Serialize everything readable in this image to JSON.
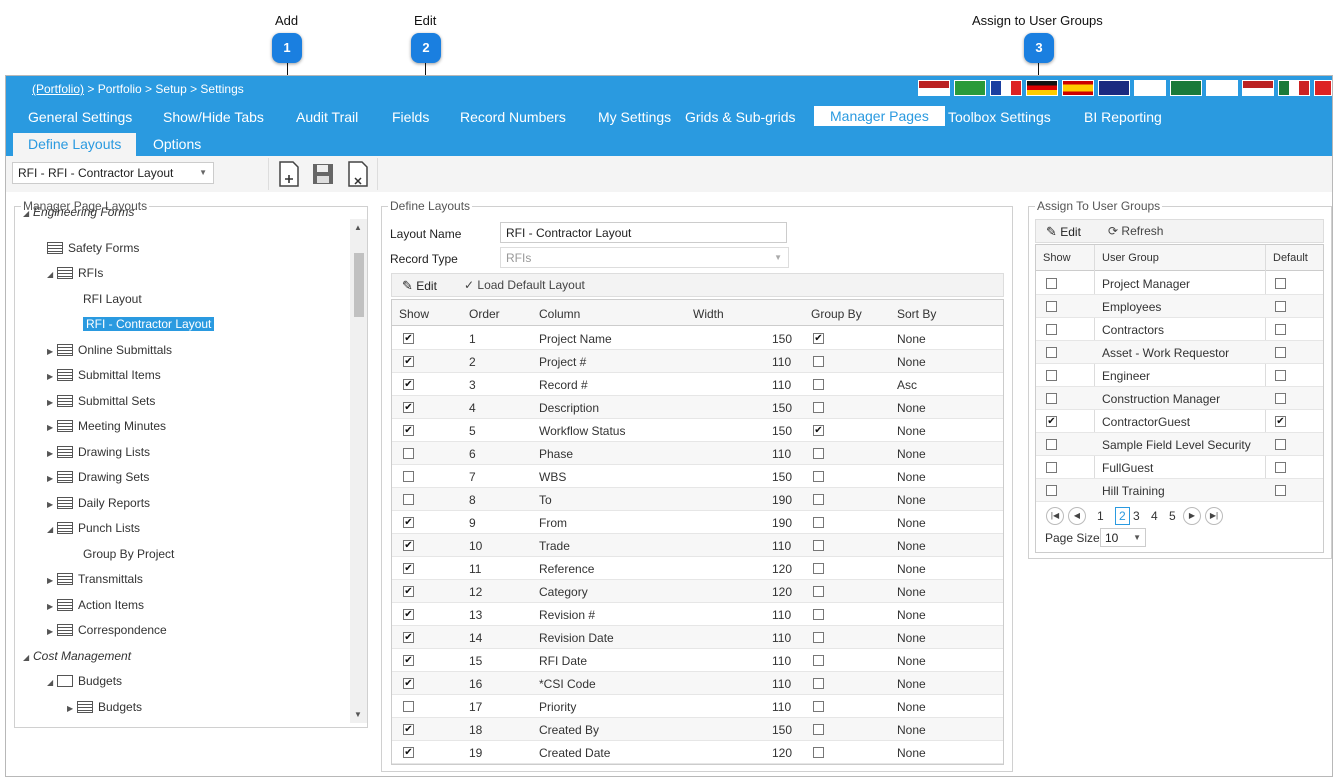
{
  "callouts": [
    {
      "label": "Add",
      "number": "1"
    },
    {
      "label": "Edit",
      "number": "2"
    },
    {
      "label": "Assign to User Groups",
      "number": "3"
    }
  ],
  "breadcrumb": {
    "link": "(Portfolio)",
    "rest": " > Portfolio > Setup > Settings"
  },
  "nav": [
    "General Settings",
    "Show/Hide Tabs",
    "Audit Trail",
    "Fields",
    "Record Numbers",
    "My Settings",
    "Grids & Sub-grids",
    "Manager Pages",
    "Toolbox Settings",
    "BI Reporting"
  ],
  "subtabs": [
    "Define Layouts",
    "Options"
  ],
  "layout_select": "RFI - RFI - Contractor Layout",
  "left_panel": {
    "legend": "Manager Page Layouts",
    "tree": [
      {
        "label": "Engineering Forms",
        "level": 0,
        "icon": "none",
        "exp": "open",
        "italic": true
      },
      {
        "label": "Safety Forms",
        "level": 1,
        "icon": "grid",
        "exp": "none"
      },
      {
        "label": "RFIs",
        "level": 1,
        "icon": "grid",
        "exp": "open"
      },
      {
        "label": "RFI Layout",
        "level": 2,
        "icon": "none",
        "exp": "none"
      },
      {
        "label": "RFI - Contractor Layout",
        "level": 2,
        "icon": "none",
        "exp": "none",
        "selected": true
      },
      {
        "label": "Online Submittals",
        "level": 1,
        "icon": "grid",
        "exp": "closed"
      },
      {
        "label": "Submittal Items",
        "level": 1,
        "icon": "grid",
        "exp": "closed"
      },
      {
        "label": "Submittal Sets",
        "level": 1,
        "icon": "grid",
        "exp": "closed"
      },
      {
        "label": "Meeting Minutes",
        "level": 1,
        "icon": "grid",
        "exp": "closed"
      },
      {
        "label": "Drawing Lists",
        "level": 1,
        "icon": "grid",
        "exp": "closed"
      },
      {
        "label": "Drawing Sets",
        "level": 1,
        "icon": "grid",
        "exp": "closed"
      },
      {
        "label": "Daily Reports",
        "level": 1,
        "icon": "grid",
        "exp": "closed"
      },
      {
        "label": "Punch Lists",
        "level": 1,
        "icon": "grid",
        "exp": "open"
      },
      {
        "label": "Group By Project",
        "level": 2,
        "icon": "none",
        "exp": "none"
      },
      {
        "label": "Transmittals",
        "level": 1,
        "icon": "grid",
        "exp": "closed"
      },
      {
        "label": "Action Items",
        "level": 1,
        "icon": "grid",
        "exp": "closed"
      },
      {
        "label": "Correspondence",
        "level": 1,
        "icon": "grid",
        "exp": "closed"
      },
      {
        "label": "Cost Management",
        "level": 0,
        "icon": "none",
        "exp": "open",
        "italic": true
      },
      {
        "label": "Budgets",
        "level": 1,
        "icon": "folder",
        "exp": "open"
      },
      {
        "label": "Budgets",
        "level": 2,
        "icon": "grid",
        "exp": "closed"
      }
    ]
  },
  "define_layouts": {
    "legend": "Define Layouts",
    "layout_name_label": "Layout Name",
    "layout_name_value": "RFI - Contractor Layout",
    "record_type_label": "Record Type",
    "record_type_value": "RFIs",
    "edit_label": "Edit",
    "load_default_label": "Load Default Layout",
    "columns": [
      "Show",
      "Order",
      "Column",
      "Width",
      "Group By",
      "Sort By"
    ],
    "rows": [
      {
        "show": true,
        "order": "1",
        "column": "Project Name",
        "width": "150",
        "group": true,
        "sort": "None"
      },
      {
        "show": true,
        "order": "2",
        "column": "Project #",
        "width": "110",
        "group": false,
        "sort": "None"
      },
      {
        "show": true,
        "order": "3",
        "column": "Record #",
        "width": "110",
        "group": false,
        "sort": "Asc"
      },
      {
        "show": true,
        "order": "4",
        "column": "Description",
        "width": "150",
        "group": false,
        "sort": "None"
      },
      {
        "show": true,
        "order": "5",
        "column": "Workflow Status",
        "width": "150",
        "group": true,
        "sort": "None"
      },
      {
        "show": false,
        "order": "6",
        "column": "Phase",
        "width": "110",
        "group": false,
        "sort": "None"
      },
      {
        "show": false,
        "order": "7",
        "column": "WBS",
        "width": "150",
        "group": false,
        "sort": "None"
      },
      {
        "show": false,
        "order": "8",
        "column": "To",
        "width": "190",
        "group": false,
        "sort": "None"
      },
      {
        "show": true,
        "order": "9",
        "column": "From",
        "width": "190",
        "group": false,
        "sort": "None"
      },
      {
        "show": true,
        "order": "10",
        "column": "Trade",
        "width": "110",
        "group": false,
        "sort": "None"
      },
      {
        "show": true,
        "order": "11",
        "column": "Reference",
        "width": "120",
        "group": false,
        "sort": "None"
      },
      {
        "show": true,
        "order": "12",
        "column": "Category",
        "width": "120",
        "group": false,
        "sort": "None"
      },
      {
        "show": true,
        "order": "13",
        "column": "Revision #",
        "width": "110",
        "group": false,
        "sort": "None"
      },
      {
        "show": true,
        "order": "14",
        "column": "Revision Date",
        "width": "110",
        "group": false,
        "sort": "None"
      },
      {
        "show": true,
        "order": "15",
        "column": "RFI Date",
        "width": "110",
        "group": false,
        "sort": "None"
      },
      {
        "show": true,
        "order": "16",
        "column": "*CSI Code",
        "width": "110",
        "group": false,
        "sort": "None"
      },
      {
        "show": false,
        "order": "17",
        "column": "Priority",
        "width": "110",
        "group": false,
        "sort": "None"
      },
      {
        "show": true,
        "order": "18",
        "column": "Created By",
        "width": "150",
        "group": false,
        "sort": "None"
      },
      {
        "show": true,
        "order": "19",
        "column": "Created Date",
        "width": "120",
        "group": false,
        "sort": "None"
      }
    ]
  },
  "assign_groups": {
    "legend": "Assign To User Groups",
    "edit_label": "Edit",
    "refresh_label": "Refresh",
    "columns": [
      "Show",
      "User Group",
      "Default"
    ],
    "rows": [
      {
        "show": false,
        "group": "Project Manager",
        "default": false
      },
      {
        "show": false,
        "group": "Employees",
        "default": false
      },
      {
        "show": false,
        "group": "Contractors",
        "default": false
      },
      {
        "show": false,
        "group": "Asset - Work Requestor",
        "default": false
      },
      {
        "show": false,
        "group": "Engineer",
        "default": false
      },
      {
        "show": false,
        "group": "Construction Manager",
        "default": false
      },
      {
        "show": true,
        "group": "ContractorGuest",
        "default": true
      },
      {
        "show": false,
        "group": "Sample Field Level Security",
        "default": false
      },
      {
        "show": false,
        "group": "FullGuest",
        "default": false
      },
      {
        "show": false,
        "group": "Hill Training",
        "default": false
      }
    ],
    "pager": {
      "pages": [
        "1",
        "2",
        "3",
        "4",
        "5"
      ],
      "current": "2",
      "page_size_label": "Page Size",
      "page_size": "10"
    }
  },
  "colors": {
    "accent": "#2a9ae0",
    "badge": "#1a7fe0"
  }
}
